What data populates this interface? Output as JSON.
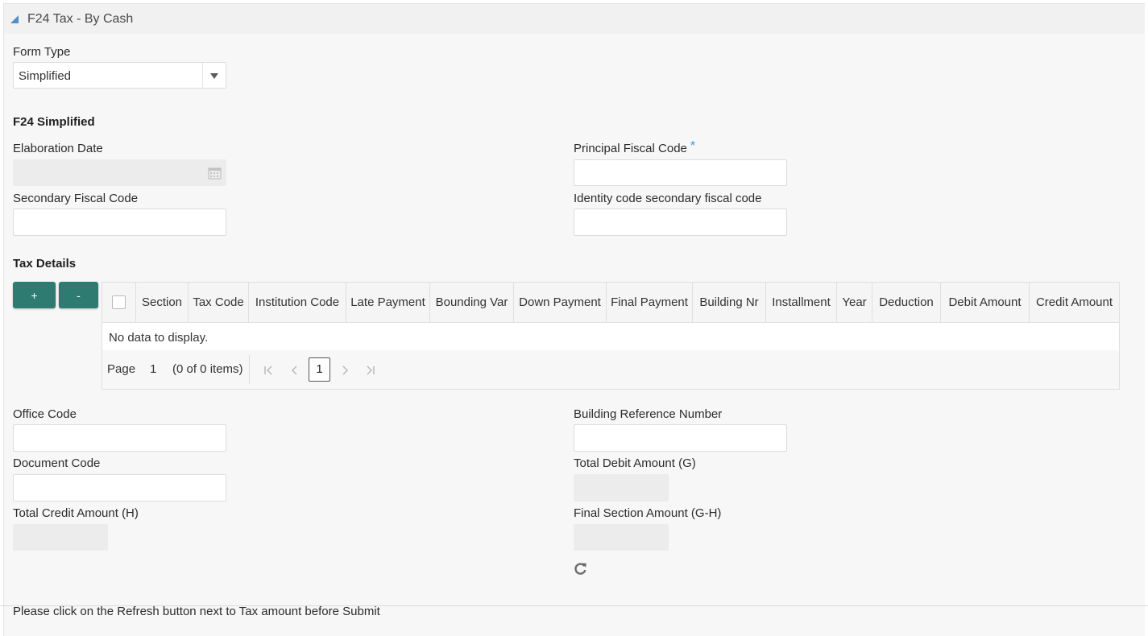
{
  "header": {
    "title": "F24 Tax - By Cash"
  },
  "form_type": {
    "label": "Form Type",
    "value": "Simplified"
  },
  "simplified": {
    "title": "F24 Simplified",
    "elaboration_date": {
      "label": "Elaboration Date",
      "value": ""
    },
    "principal_fiscal_code": {
      "label": "Principal Fiscal Code",
      "required_mark": "*",
      "value": ""
    },
    "secondary_fiscal_code": {
      "label": "Secondary Fiscal Code",
      "value": ""
    },
    "identity_code": {
      "label": "Identity code secondary fiscal code",
      "value": ""
    }
  },
  "tax_details": {
    "title": "Tax Details",
    "add_label": "+",
    "remove_label": "-",
    "columns": [
      "Section",
      "Tax Code",
      "Institution Code",
      "Late Payment",
      "Bounding Var",
      "Down Payment",
      "Final Payment",
      "Building Nr",
      "Installment",
      "Year",
      "Deduction",
      "Debit Amount",
      "Credit Amount"
    ],
    "empty_text": "No data to display.",
    "pager": {
      "page_label": "Page",
      "page_value": "1",
      "items_text": "(0 of 0 items)",
      "current_page": "1"
    }
  },
  "office_code": {
    "label": "Office Code",
    "value": ""
  },
  "building_reference_number": {
    "label": "Building Reference Number",
    "value": ""
  },
  "document_code": {
    "label": "Document Code",
    "value": ""
  },
  "total_debit_amount": {
    "label": "Total Debit Amount (G)",
    "value": ""
  },
  "total_credit_amount": {
    "label": "Total Credit Amount (H)",
    "value": ""
  },
  "final_section_amount": {
    "label": "Final Section Amount (G-H)",
    "value": ""
  },
  "footer": {
    "note": "Please click on the Refresh button next to Tax amount before Submit"
  },
  "colors": {
    "accent_button": "#2e7b72",
    "required_mark": "#3b9ad9",
    "panel_bg": "#f7f7f7"
  }
}
